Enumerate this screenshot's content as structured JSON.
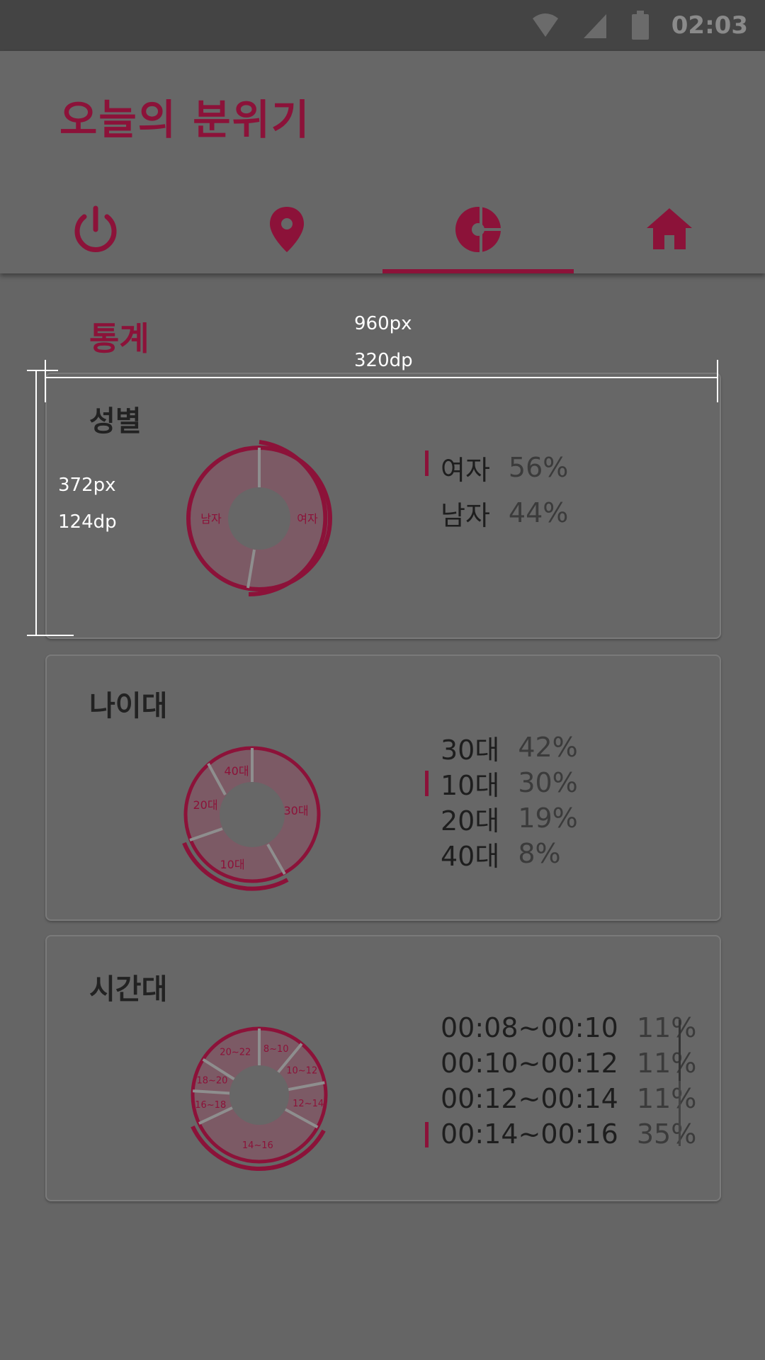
{
  "status_bar": {
    "time": "02:03",
    "icons": [
      "wifi-icon",
      "signal-icon",
      "battery-icon"
    ]
  },
  "app": {
    "title": "오늘의 분위기",
    "accent": "#8c1239"
  },
  "tabs": [
    {
      "name": "power",
      "icon": "power-icon",
      "active": false
    },
    {
      "name": "location",
      "icon": "location-pin-icon",
      "active": false
    },
    {
      "name": "statistics",
      "icon": "pie-chart-icon",
      "active": true
    },
    {
      "name": "home",
      "icon": "home-icon",
      "active": false
    }
  ],
  "section": {
    "title": "통계"
  },
  "annotations": {
    "width_px": "960px",
    "width_dp": "320dp",
    "height_px": "372px",
    "height_dp": "124dp"
  },
  "cards": {
    "gender": {
      "title": "성별",
      "items": [
        {
          "label": "여자",
          "pct": "56%",
          "value": 56,
          "selected": true
        },
        {
          "label": "남자",
          "pct": "44%",
          "value": 44,
          "selected": false
        }
      ]
    },
    "age": {
      "title": "나이대",
      "items": [
        {
          "label": "30대",
          "pct": "42%",
          "value": 42,
          "selected": false
        },
        {
          "label": "10대",
          "pct": "30%",
          "value": 30,
          "selected": true
        },
        {
          "label": "20대",
          "pct": "19%",
          "value": 19,
          "selected": false
        },
        {
          "label": "40대",
          "pct": "8%",
          "value": 8,
          "selected": false
        }
      ]
    },
    "time": {
      "title": "시간대",
      "items": [
        {
          "label": "00:08~00:10",
          "pct": "11%",
          "selected": false
        },
        {
          "label": "00:10~00:12",
          "pct": "11%",
          "selected": false
        },
        {
          "label": "00:12~00:14",
          "pct": "11%",
          "selected": false
        },
        {
          "label": "00:14~00:16",
          "pct": "35%",
          "selected": true
        }
      ],
      "slices": [
        {
          "label": "8~10",
          "value": 11
        },
        {
          "label": "10~12",
          "value": 11
        },
        {
          "label": "12~14",
          "value": 11
        },
        {
          "label": "14~16",
          "value": 35
        },
        {
          "label": "16~18",
          "value": 8
        },
        {
          "label": "18~20",
          "value": 8
        },
        {
          "label": "20~22",
          "value": 16
        }
      ]
    }
  }
}
